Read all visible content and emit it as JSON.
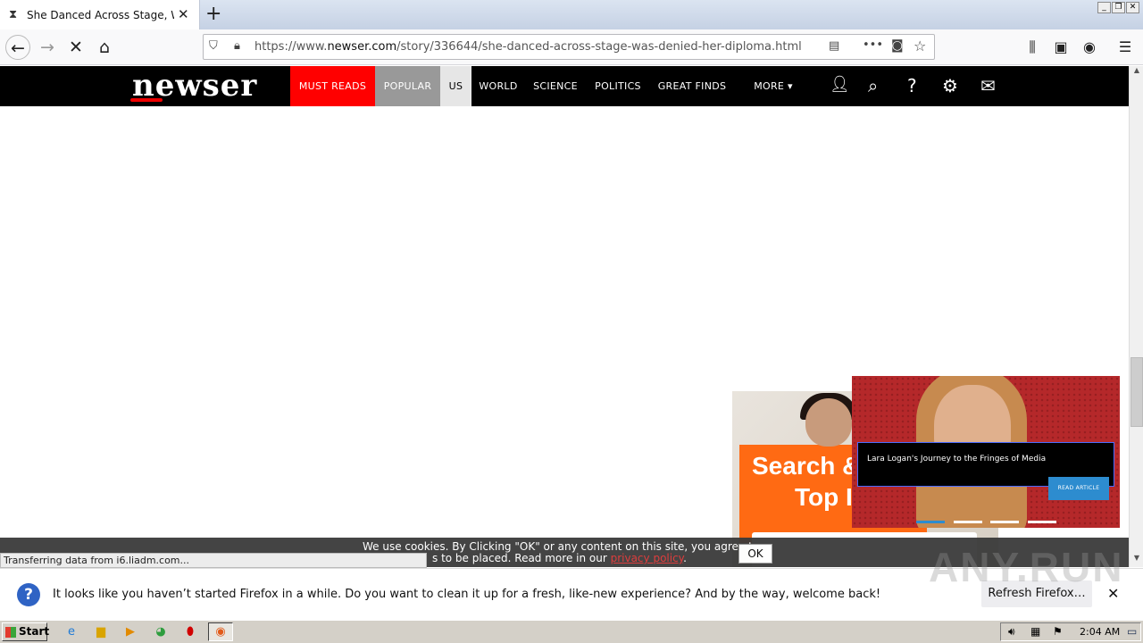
{
  "browser": {
    "tab_title": "She Danced Across Stage, Was Denied Her Diploma",
    "url_prefix": "https://www.",
    "url_domain": "newser.com",
    "url_path": "/story/336644/she-danced-across-stage-was-denied-her-diploma.html",
    "status_text": "Transferring data from i6.liadm.com..."
  },
  "site": {
    "logo_text": "newser",
    "nav": [
      "MUST READS",
      "POPULAR",
      "US",
      "WORLD",
      "SCIENCE",
      "POLITICS",
      "GREAT FINDS",
      "MORE ▾"
    ],
    "brand_red": "#e00000"
  },
  "ad": {
    "line1": "Search &",
    "line2": "Top I"
  },
  "video": {
    "caption": "Lara Logan's Journey to the Fringes of Media",
    "button": "READ ARTICLE"
  },
  "cookie": {
    "line1": "We use cookies. By Clicking \"OK\" or any content on this site, you agree to",
    "line2_pre": "s to be placed. Read more in our ",
    "link": "privacy policy",
    "line2_post": ".",
    "ok": "OK"
  },
  "notification": {
    "message": "It looks like you haven’t started Firefox in a while. Do you want to clean it up for a fresh, like-new experience? And by the way, welcome back!",
    "button": "Refresh Firefox…"
  },
  "watermark": "ANY.RUN",
  "taskbar": {
    "start": "Start",
    "clock": "2:04 AM"
  }
}
